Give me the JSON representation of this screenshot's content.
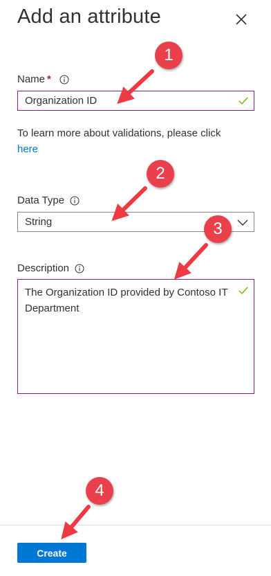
{
  "panel": {
    "title": "Add an attribute"
  },
  "fields": {
    "name": {
      "label": "Name",
      "required_mark": "*",
      "value": "Organization ID"
    },
    "help_text": "To learn more about validations, please click",
    "help_link": "here",
    "data_type": {
      "label": "Data Type",
      "selected": "String"
    },
    "description": {
      "label": "Description",
      "value": "The Organization ID provided by Contoso IT Department"
    }
  },
  "footer": {
    "create_label": "Create"
  },
  "annotations": {
    "steps": [
      "1",
      "2",
      "3",
      "4"
    ],
    "color": "#e8414b"
  },
  "colors": {
    "accent": "#0078d4",
    "focus_border": "#8a1a8a",
    "valid_check": "#6bb700"
  },
  "icons": {
    "close": "close-icon",
    "info": "info-icon",
    "check": "checkmark-icon",
    "dropdown": "chevron-down-icon"
  }
}
